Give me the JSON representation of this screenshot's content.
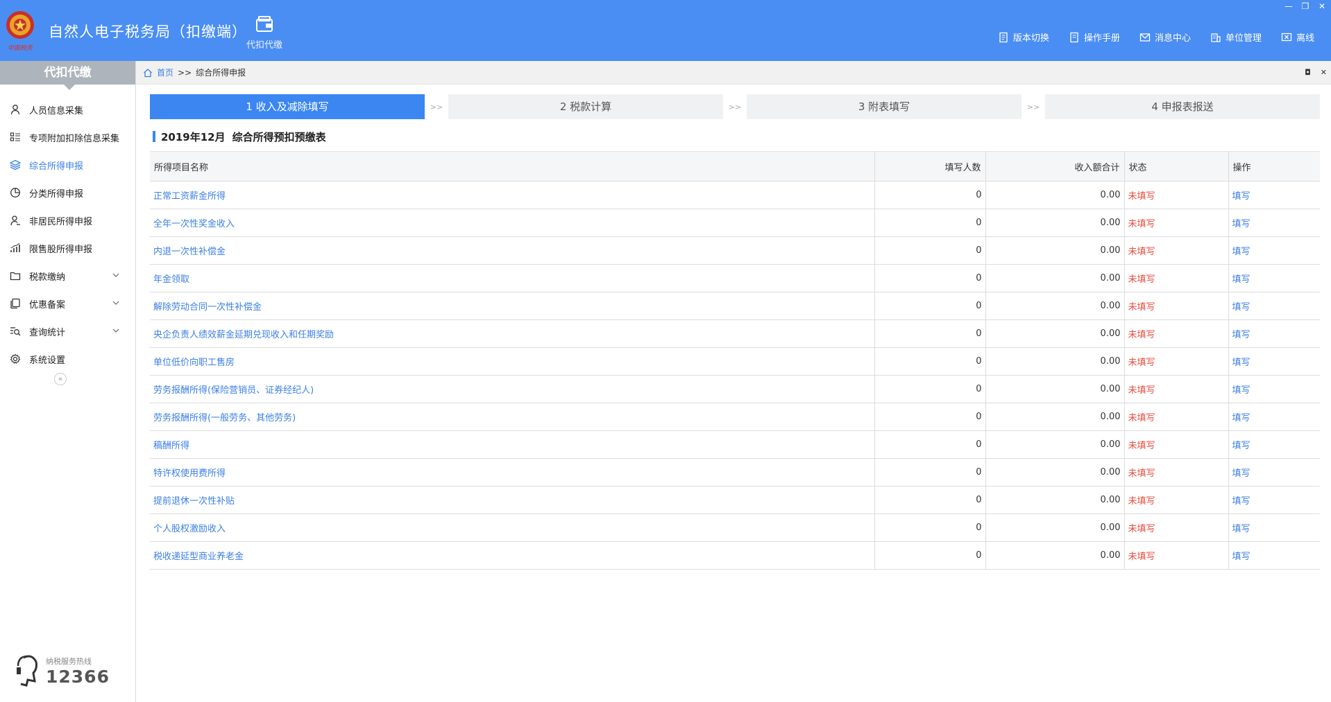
{
  "header": {
    "app_title": "自然人电子税务局（扣缴端）",
    "logo_text": "中国税务",
    "module_label": "代扣代缴",
    "actions": [
      {
        "label": "版本切换",
        "icon": "version-icon"
      },
      {
        "label": "操作手册",
        "icon": "manual-icon"
      },
      {
        "label": "消息中心",
        "icon": "message-icon"
      },
      {
        "label": "单位管理",
        "icon": "company-icon"
      },
      {
        "label": "离线",
        "icon": "offline-icon"
      }
    ],
    "window_controls": [
      "—",
      "❐",
      "✕"
    ]
  },
  "sidebar": {
    "title": "代扣代缴",
    "items": [
      {
        "label": "人员信息采集",
        "icon": "person-icon",
        "active": false,
        "expandable": false
      },
      {
        "label": "专项附加扣除信息采集",
        "icon": "list-icon",
        "active": false,
        "expandable": false
      },
      {
        "label": "综合所得申报",
        "icon": "layers-icon",
        "active": true,
        "expandable": false
      },
      {
        "label": "分类所得申报",
        "icon": "pie-icon",
        "active": false,
        "expandable": false
      },
      {
        "label": "非居民所得申报",
        "icon": "user-icon",
        "active": false,
        "expandable": false
      },
      {
        "label": "限售股所得申报",
        "icon": "chart-icon",
        "active": false,
        "expandable": false
      },
      {
        "label": "税款缴纳",
        "icon": "folder-icon",
        "active": false,
        "expandable": true
      },
      {
        "label": "优惠备案",
        "icon": "copy-icon",
        "active": false,
        "expandable": true
      },
      {
        "label": "查询统计",
        "icon": "search-list-icon",
        "active": false,
        "expandable": true
      },
      {
        "label": "系统设置",
        "icon": "gear-icon",
        "active": false,
        "expandable": false
      }
    ],
    "collapse_label": "«",
    "hotline_label": "纳税服务热线",
    "hotline_number": "12366"
  },
  "breadcrumb": {
    "home": "首页",
    "separator": ">>",
    "current": "综合所得申报",
    "controls": [
      "◘",
      "✕"
    ]
  },
  "steps": [
    {
      "label": "1 收入及减除填写",
      "active": true
    },
    {
      "label": "2 税款计算",
      "active": false
    },
    {
      "label": "3 附表填写",
      "active": false
    },
    {
      "label": "4 申报表报送",
      "active": false
    }
  ],
  "step_arrow": ">>",
  "form": {
    "period": "2019年12月",
    "title": "综合所得预扣预缴表"
  },
  "table": {
    "columns": [
      "所得项目名称",
      "填写人数",
      "收入额合计",
      "状态",
      "操作"
    ],
    "rows": [
      {
        "name": "正常工资薪金所得",
        "count": "0",
        "amount": "0.00",
        "status": "未填写",
        "action": "填写"
      },
      {
        "name": "全年一次性奖金收入",
        "count": "0",
        "amount": "0.00",
        "status": "未填写",
        "action": "填写"
      },
      {
        "name": "内退一次性补偿金",
        "count": "0",
        "amount": "0.00",
        "status": "未填写",
        "action": "填写"
      },
      {
        "name": "年金领取",
        "count": "0",
        "amount": "0.00",
        "status": "未填写",
        "action": "填写"
      },
      {
        "name": "解除劳动合同一次性补偿金",
        "count": "0",
        "amount": "0.00",
        "status": "未填写",
        "action": "填写"
      },
      {
        "name": "央企负责人绩效薪金延期兑现收入和任期奖励",
        "count": "0",
        "amount": "0.00",
        "status": "未填写",
        "action": "填写"
      },
      {
        "name": "单位低价向职工售房",
        "count": "0",
        "amount": "0.00",
        "status": "未填写",
        "action": "填写"
      },
      {
        "name": "劳务报酬所得(保险营销员、证券经纪人)",
        "count": "0",
        "amount": "0.00",
        "status": "未填写",
        "action": "填写"
      },
      {
        "name": "劳务报酬所得(一般劳务、其他劳务)",
        "count": "0",
        "amount": "0.00",
        "status": "未填写",
        "action": "填写"
      },
      {
        "name": "稿酬所得",
        "count": "0",
        "amount": "0.00",
        "status": "未填写",
        "action": "填写"
      },
      {
        "name": "特许权使用费所得",
        "count": "0",
        "amount": "0.00",
        "status": "未填写",
        "action": "填写"
      },
      {
        "name": "提前退休一次性补贴",
        "count": "0",
        "amount": "0.00",
        "status": "未填写",
        "action": "填写"
      },
      {
        "name": "个人股权激励收入",
        "count": "0",
        "amount": "0.00",
        "status": "未填写",
        "action": "填写"
      },
      {
        "name": "税收递延型商业养老金",
        "count": "0",
        "amount": "0.00",
        "status": "未填写",
        "action": "填写"
      }
    ]
  },
  "colors": {
    "header_bg": "#4a8ef4",
    "active_step": "#3b86f1",
    "link": "#3b7fe6",
    "status_red": "#e84c3d",
    "sidebar_head": "#aeb4bc"
  }
}
